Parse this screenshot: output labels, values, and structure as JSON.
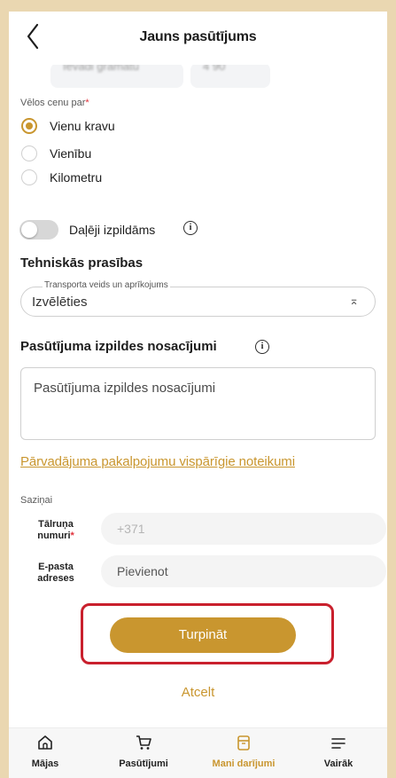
{
  "header": {
    "title": "Jauns pasūtījums"
  },
  "peek": {
    "left_text": "Ievadi gramatu",
    "right_text": "4 90"
  },
  "price": {
    "label": "Vēlos cenu par",
    "required_mark": "*",
    "options": [
      {
        "label": "Vienu kravu",
        "checked": true
      },
      {
        "label": "Vienību",
        "checked": false
      },
      {
        "label": "Kilometru",
        "checked": false
      }
    ]
  },
  "partial": {
    "label": "Daļēji izpildāms",
    "enabled": false
  },
  "technical": {
    "heading": "Tehniskās prasības",
    "legend": "Transporta veids un aprīkojums",
    "value": "Izvēlēties"
  },
  "conditions": {
    "heading": "Pasūtījuma izpildes nosacījumi",
    "placeholder": "Pasūtījuma izpildes nosacījumi"
  },
  "terms_link": "Pārvadājuma pakalpojumu vispārīgie noteikumi",
  "contact": {
    "heading": "Saziņai",
    "phone_label_line1": "Tālruņa",
    "phone_label_line2": "numuri",
    "phone_required_mark": "*",
    "phone_placeholder": "+371",
    "email_label_line1": "E-pasta",
    "email_label_line2": "adreses",
    "email_value": "Pievienot"
  },
  "actions": {
    "continue_label": "Turpināt",
    "cancel_label": "Atcelt"
  },
  "tabs": [
    {
      "label": "Mājas",
      "icon": "home-icon",
      "active": false
    },
    {
      "label": "Pasūtījumi",
      "icon": "cart-icon",
      "active": false
    },
    {
      "label": "Mani darījumi",
      "icon": "deals-icon",
      "active": true
    },
    {
      "label": "Vairāk",
      "icon": "menu-icon",
      "active": false
    }
  ],
  "colors": {
    "accent": "#c9962f",
    "highlight": "#c9202d",
    "background": "#ead7b1"
  }
}
